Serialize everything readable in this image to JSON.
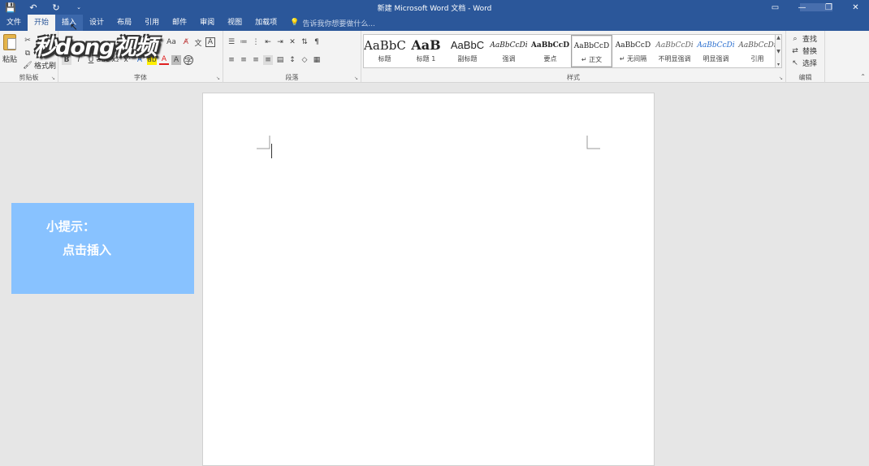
{
  "window": {
    "title": "新建 Microsoft Word 文档 - Word",
    "qat": [
      "💾",
      "↶",
      "↻",
      "⌄"
    ],
    "controls": [
      "▭",
      "—",
      "❐",
      "✕"
    ]
  },
  "tabs": {
    "file": "文件",
    "home": "开始",
    "insert": "插入",
    "design": "设计",
    "layout": "布局",
    "references": "引用",
    "mailings": "邮件",
    "review": "审阅",
    "view": "视图",
    "addins": "加载项",
    "tell_me": "告诉我你想要做什么..."
  },
  "clipboard": {
    "paste": "粘贴",
    "format_painter": "格式刷",
    "group_label": "剪贴板"
  },
  "font": {
    "group_label": "字体",
    "bold": "B",
    "italic": "I",
    "underline": "U",
    "size_toggle": "Aa",
    "subscript": "x₂",
    "superscript": "x²"
  },
  "paragraph": {
    "group_label": "段落"
  },
  "styles": {
    "group_label": "样式",
    "items": [
      {
        "sample": "AaBbC",
        "name": "标题"
      },
      {
        "sample": "AaB",
        "name": "标题 1"
      },
      {
        "sample": "AaBbC",
        "name": "副标题"
      },
      {
        "sample": "AaBbCcDi",
        "name": "强调"
      },
      {
        "sample": "AaBbCcD",
        "name": "要点"
      },
      {
        "sample": "AaBbCcD",
        "name": "↵ 正文"
      },
      {
        "sample": "AaBbCcD",
        "name": "↵ 无间隔"
      },
      {
        "sample": "AaBbCcDi",
        "name": "不明显强调"
      },
      {
        "sample": "AaBbCcDi",
        "name": "明显强调"
      },
      {
        "sample": "AaBbCcDi",
        "name": "引用"
      }
    ]
  },
  "editing": {
    "group_label": "编辑",
    "find": "查找",
    "replace": "替换",
    "select": "选择"
  },
  "watermark": "秒dong视频",
  "hint": {
    "title": "小提示：",
    "body": "点击插入"
  },
  "colors": {
    "accent": "#2b579a",
    "hint_bg": "#88c2ff",
    "font_color": "#e02020",
    "highlight": "#ffee00"
  }
}
